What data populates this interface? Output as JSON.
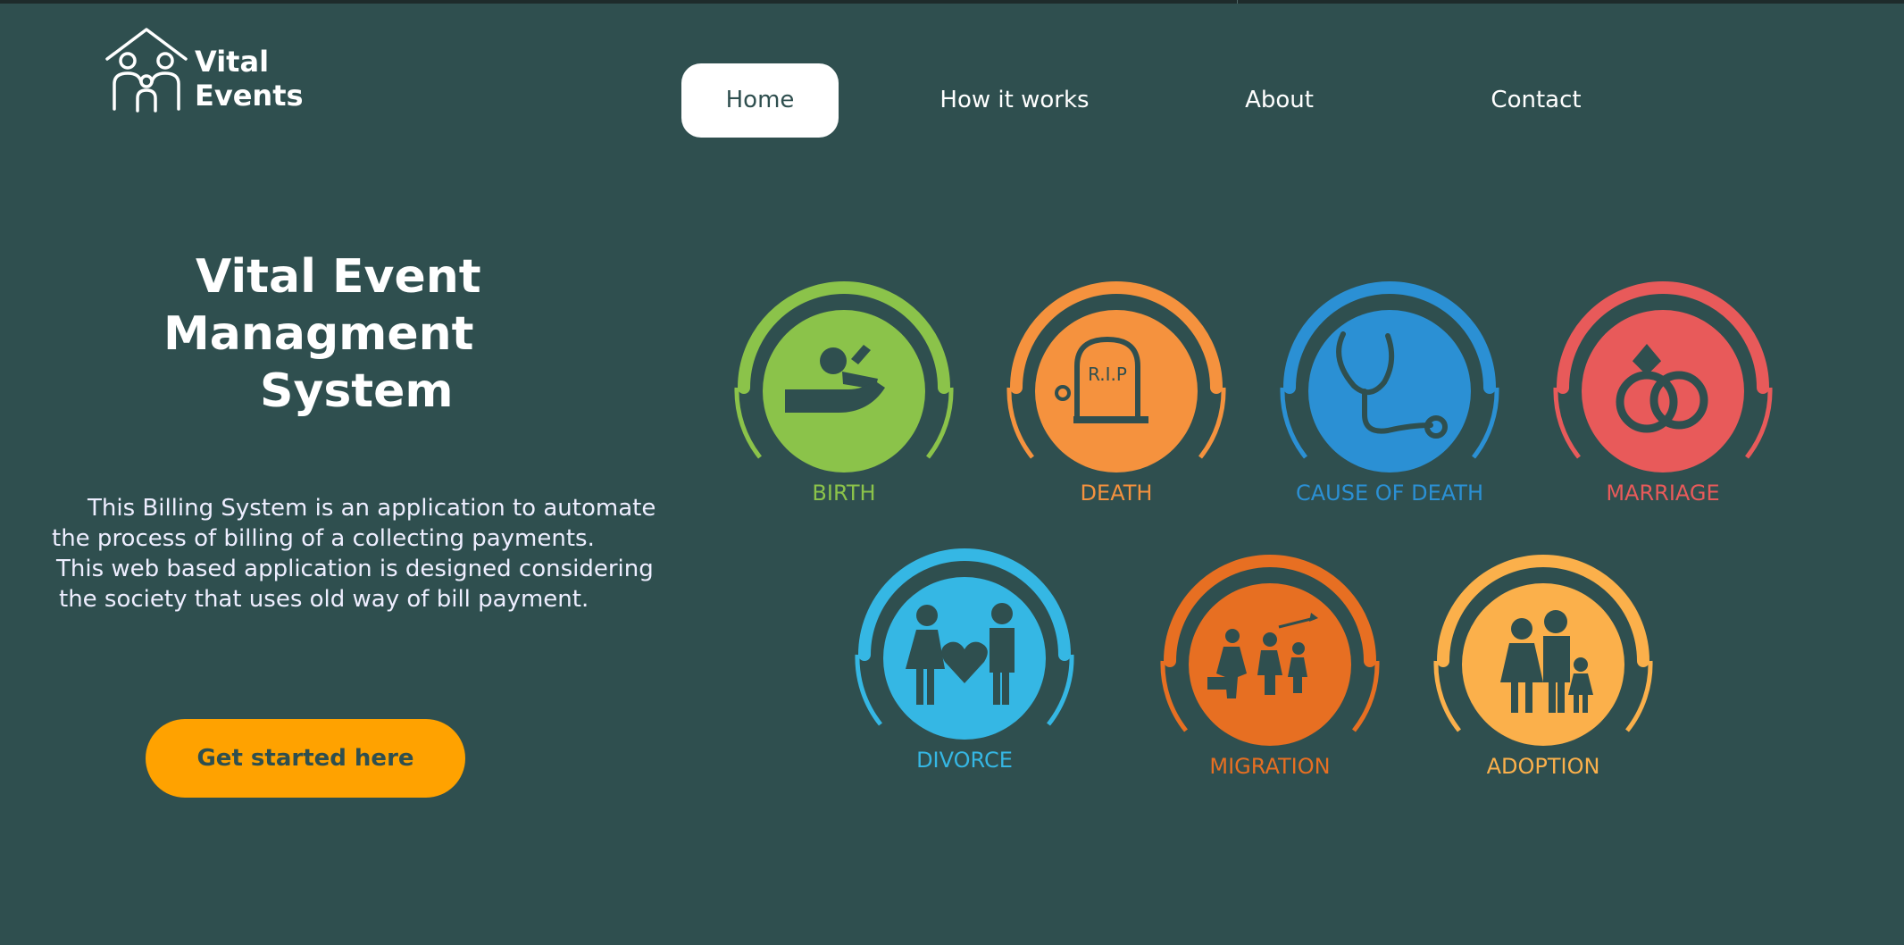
{
  "brand": {
    "line1": "Vital",
    "line2": "Events"
  },
  "nav": {
    "items": [
      "Home",
      "How it works",
      "About",
      "Contact"
    ],
    "active": "Home"
  },
  "hero": {
    "title": [
      "Vital Event",
      "Managment",
      "System"
    ],
    "description": [
      "This Billing System is an application to automate",
      "the process of billing of a collecting payments.",
      "This web based application is designed considering",
      "the society that uses old way of bill payment."
    ],
    "cta": "Get started here"
  },
  "events": [
    {
      "label": "BIRTH",
      "color": "#8bc34a",
      "icon": "birth-icon"
    },
    {
      "label": "DEATH",
      "color": "#f5923e",
      "icon": "tombstone-icon",
      "icon_text": "R.I.P"
    },
    {
      "label": "CAUSE OF DEATH",
      "color": "#2b90d4",
      "icon": "stethoscope-icon"
    },
    {
      "label": "MARRIAGE",
      "color": "#e85a5a",
      "icon": "rings-icon"
    },
    {
      "label": "DIVORCE",
      "color": "#35b7e4",
      "icon": "broken-heart-couple-icon"
    },
    {
      "label": "MIGRATION",
      "color": "#e76f22",
      "icon": "migrating-people-icon"
    },
    {
      "label": "ADOPTION",
      "color": "#fbb04b",
      "icon": "family-icon"
    }
  ],
  "colors": {
    "background": "#2f4f4f",
    "cta": "#ffa200",
    "text": "#ffffff"
  }
}
